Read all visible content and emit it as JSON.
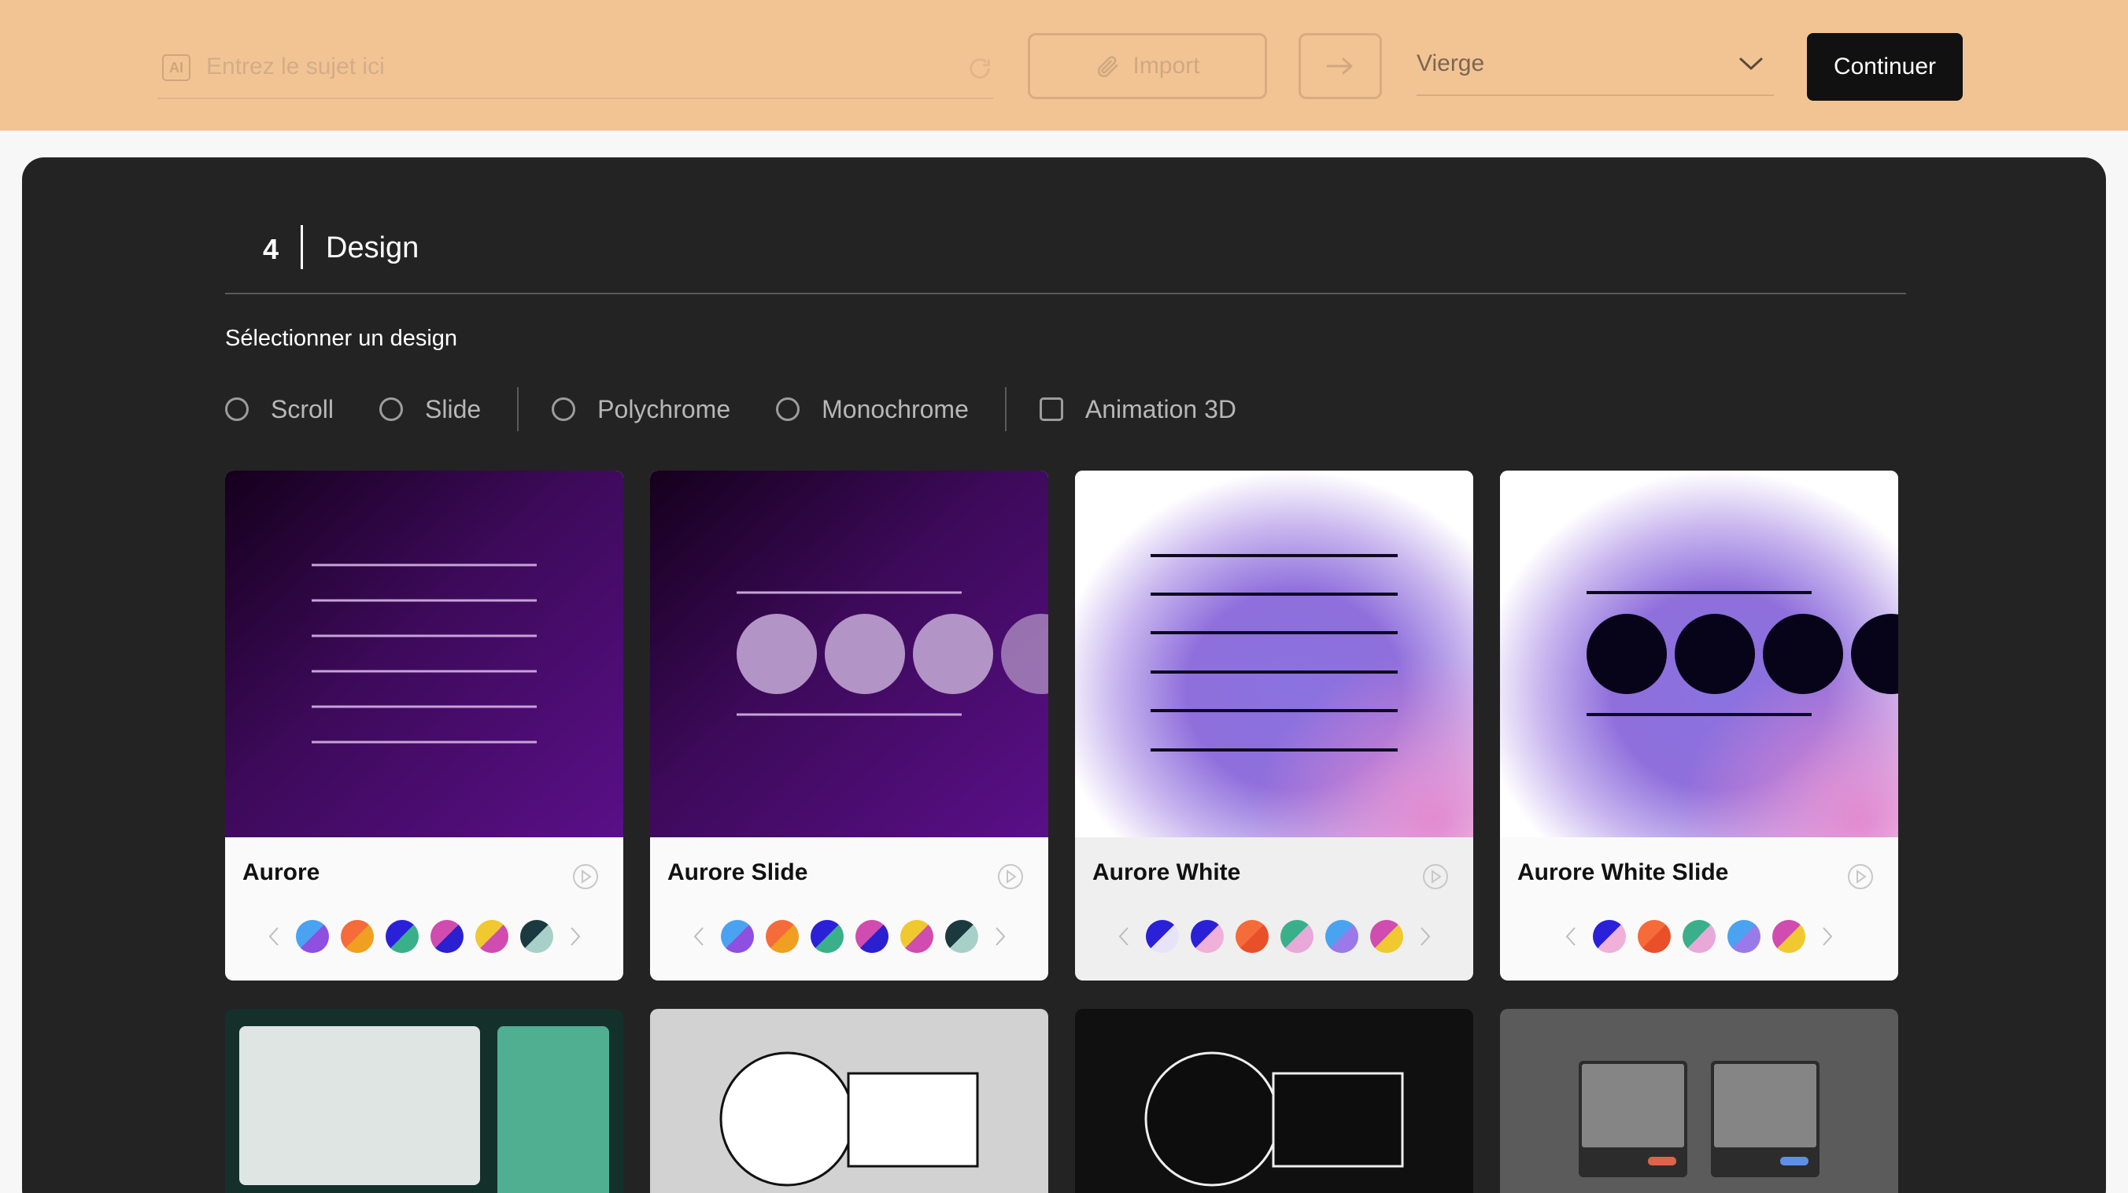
{
  "topbar": {
    "ai_badge": "AI",
    "subject_placeholder": "Entrez le sujet ici",
    "import_label": "Import",
    "template_select": "Vierge",
    "continue_label": "Continuer"
  },
  "step": {
    "number": "4",
    "title": "Design"
  },
  "select_label": "Sélectionner un design",
  "filters": [
    {
      "label": "Scroll",
      "type": "radio"
    },
    {
      "label": "Slide",
      "type": "radio"
    },
    {
      "label": "Polychrome",
      "type": "radio"
    },
    {
      "label": "Monochrome",
      "type": "radio"
    },
    {
      "label": "Animation 3D",
      "type": "checkbox"
    }
  ],
  "designs": [
    {
      "name": "Aurore",
      "swatches": [
        [
          "#4aa3f0",
          "#8f4fe0"
        ],
        [
          "#f56b3a",
          "#f0a020"
        ],
        [
          "#2a20d8",
          "#3ab08a"
        ],
        [
          "#d04cb0",
          "#2a20d0"
        ],
        [
          "#f0c830",
          "#d04cb0"
        ],
        [
          "#1a3a40",
          "#a8d0c8"
        ]
      ]
    },
    {
      "name": "Aurore Slide",
      "swatches": [
        [
          "#4aa3f0",
          "#8f4fe0"
        ],
        [
          "#f56b3a",
          "#f0a020"
        ],
        [
          "#2a20d8",
          "#3ab08a"
        ],
        [
          "#d04cb0",
          "#2a20d0"
        ],
        [
          "#f0c830",
          "#d04cb0"
        ],
        [
          "#1a3a40",
          "#a8d0c8"
        ]
      ]
    },
    {
      "name": "Aurore White",
      "swatches": [
        [
          "#2a20d8",
          "#e8e4f8"
        ],
        [
          "#2a20d8",
          "#f0b0d8"
        ],
        [
          "#f56b3a",
          "#e8502a"
        ],
        [
          "#3ab08a",
          "#e8a8d8"
        ],
        [
          "#4aa3f0",
          "#9a7ae8"
        ],
        [
          "#d04cb0",
          "#f0c830"
        ]
      ]
    },
    {
      "name": "Aurore White Slide",
      "swatches": [
        [
          "#2a20d8",
          "#f0b0d8"
        ],
        [
          "#f56b3a",
          "#e8502a"
        ],
        [
          "#3ab08a",
          "#e8a8d8"
        ],
        [
          "#4aa3f0",
          "#9a7ae8"
        ],
        [
          "#d04cb0",
          "#f0c830"
        ]
      ]
    }
  ],
  "icons": {
    "ai": "ai-badge-icon",
    "refresh": "refresh-icon",
    "paperclip": "paperclip-icon",
    "arrow": "arrow-right-icon",
    "chevron": "chevron-down-icon",
    "play": "play-icon"
  }
}
